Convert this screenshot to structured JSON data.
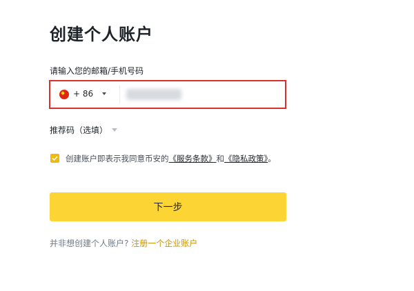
{
  "page": {
    "title": "创建个人账户"
  },
  "phone_field": {
    "label": "请输入您的邮箱/手机号码",
    "country_flag": "china-flag-icon",
    "dial_code": "+ 86",
    "value": ""
  },
  "referral": {
    "label": "推荐码（选填）"
  },
  "agreement": {
    "checked": true,
    "text_before": "创建账户即表示我同意币安的",
    "terms_link": "《服务条款》",
    "text_and": "和",
    "privacy_link": "《隐私政策》",
    "text_end": "。"
  },
  "next_button": {
    "label": "下一步"
  },
  "footer": {
    "prompt": "并非想创建个人账户?",
    "link": "注册一个企业账户"
  },
  "colors": {
    "accent_yellow": "#fcd535",
    "checkbox_yellow": "#f0b90b",
    "error_border": "#d9302c",
    "link_gold": "#c99400"
  }
}
